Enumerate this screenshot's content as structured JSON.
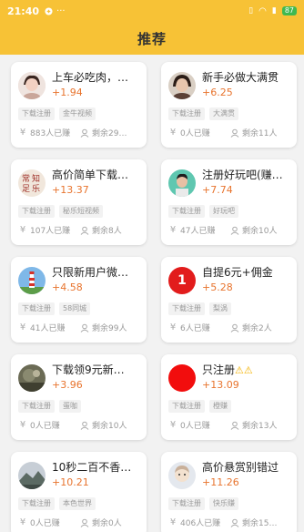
{
  "status": {
    "time": "21:40",
    "battery": "87"
  },
  "app": {
    "title": "推荐"
  },
  "cards": [
    {
      "title": "上车必吃肉，…",
      "reward": "+1.94",
      "tags": [
        "下载注册",
        "金牛视频"
      ],
      "earned": "883人已赚",
      "remaining": "剩余29…",
      "avatar": "girl-avatar"
    },
    {
      "title": "新手必做大满贯",
      "reward": "+6.25",
      "tags": [
        "下载注册",
        "大满贯"
      ],
      "earned": "0人已赚",
      "remaining": "剩余11人",
      "avatar": "girl-avatar"
    },
    {
      "title": "高价简单下载…",
      "reward": "+13.37",
      "tags": [
        "下载注册",
        "秘乐短视频"
      ],
      "earned": "107人已赚",
      "remaining": "剩余8人",
      "avatar": "calligraphy-avatar"
    },
    {
      "title": "注册好玩吧(赚…",
      "reward": "+7.74",
      "tags": [
        "下载注册",
        "好玩吧"
      ],
      "earned": "47人已赚",
      "remaining": "剩余10人",
      "avatar": "person-avatar"
    },
    {
      "title": "只限新用户微…",
      "reward": "+4.58",
      "tags": [
        "下载注册",
        "58同城"
      ],
      "earned": "41人已赚",
      "remaining": "剩余99人",
      "avatar": "lighthouse-avatar"
    },
    {
      "title": "自提6元+佣金",
      "reward": "+5.28",
      "tags": [
        "下载注册",
        "梨涡"
      ],
      "earned": "6人已赚",
      "remaining": "剩余2人",
      "avatar": "red-badge-avatar",
      "badge": "1"
    },
    {
      "title": "下载领9元新…",
      "reward": "+3.96",
      "tags": [
        "下载注册",
        "蛋咖"
      ],
      "earned": "0人已赚",
      "remaining": "剩余10人",
      "avatar": "landscape-avatar"
    },
    {
      "title": "只注册",
      "reward": "+13.09",
      "tags": [
        "下载注册",
        "橙赚"
      ],
      "earned": "0人已赚",
      "remaining": "剩余13人",
      "avatar": "red-circle-avatar",
      "suffix": "⚠⚠"
    },
    {
      "title": "10秒二百不香…",
      "reward": "+10.21",
      "tags": [
        "下载注册",
        "本色世界"
      ],
      "earned": "0人已赚",
      "remaining": "剩余0人",
      "avatar": "mountain-avatar"
    },
    {
      "title": "高价悬赏别错过",
      "reward": "+11.26",
      "tags": [
        "下载注册",
        "快乐赚"
      ],
      "earned": "406人已赚",
      "remaining": "剩余15…",
      "avatar": "cartoon-avatar"
    }
  ]
}
